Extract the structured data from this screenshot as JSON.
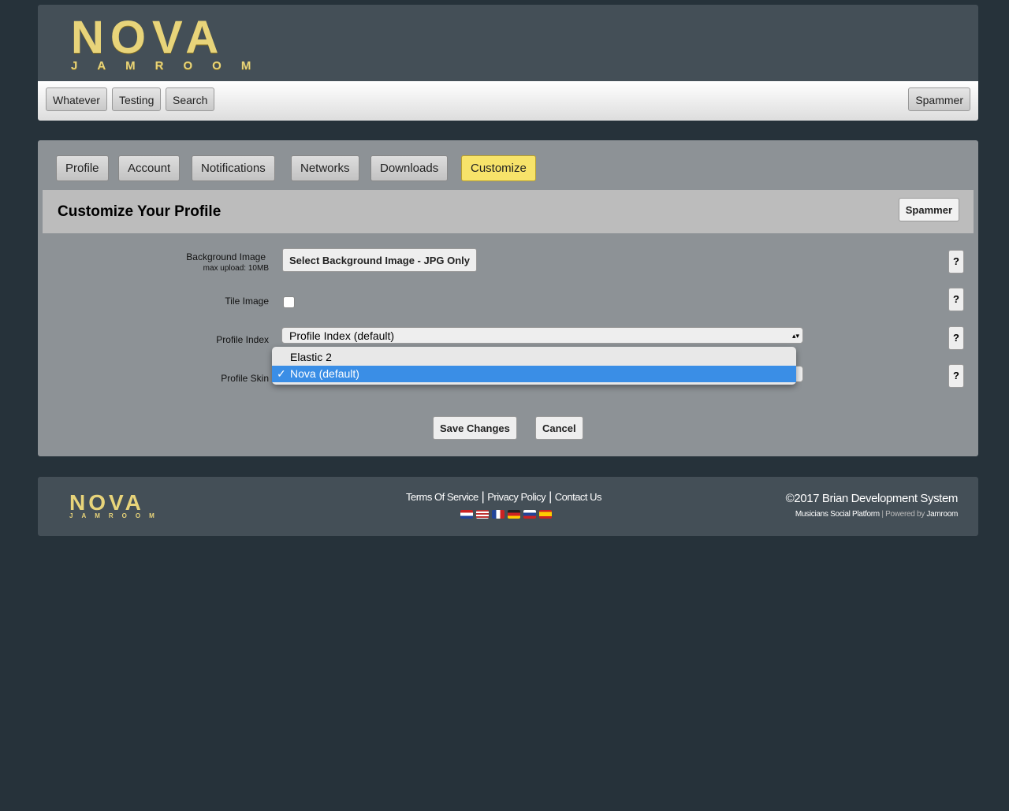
{
  "logo": {
    "title": "NOVA",
    "subtitle": "JAMROOM"
  },
  "nav": {
    "items": [
      "Whatever",
      "Testing",
      "Search"
    ],
    "user": "Spammer"
  },
  "tabs": [
    "Profile",
    "Account",
    "Notifications",
    "Networks",
    "Downloads",
    "Customize"
  ],
  "active_tab": "Customize",
  "section": {
    "title": "Customize Your Profile",
    "user_button": "Spammer"
  },
  "form": {
    "bg_label": "Background Image",
    "bg_sub": "max upload: 10MB",
    "bg_button": "Select Background Image - JPG Only",
    "tile_label": "Tile Image",
    "tile_checked": false,
    "index_label": "Profile Index",
    "index_value": "Profile Index (default)",
    "skin_label": "Profile Skin",
    "skin_options": [
      "Elastic 2",
      "Nova (default)"
    ],
    "skin_selected": "Nova (default)",
    "help": "?",
    "save": "Save Changes",
    "cancel": "Cancel"
  },
  "footer": {
    "links": [
      "Terms Of Service",
      "Privacy Policy",
      "Contact Us"
    ],
    "sep": "|",
    "copyright": "©2017 Brian Development System",
    "tagline": "Musicians Social Platform",
    "powered": "Powered by",
    "powered_by": "Jamroom"
  }
}
